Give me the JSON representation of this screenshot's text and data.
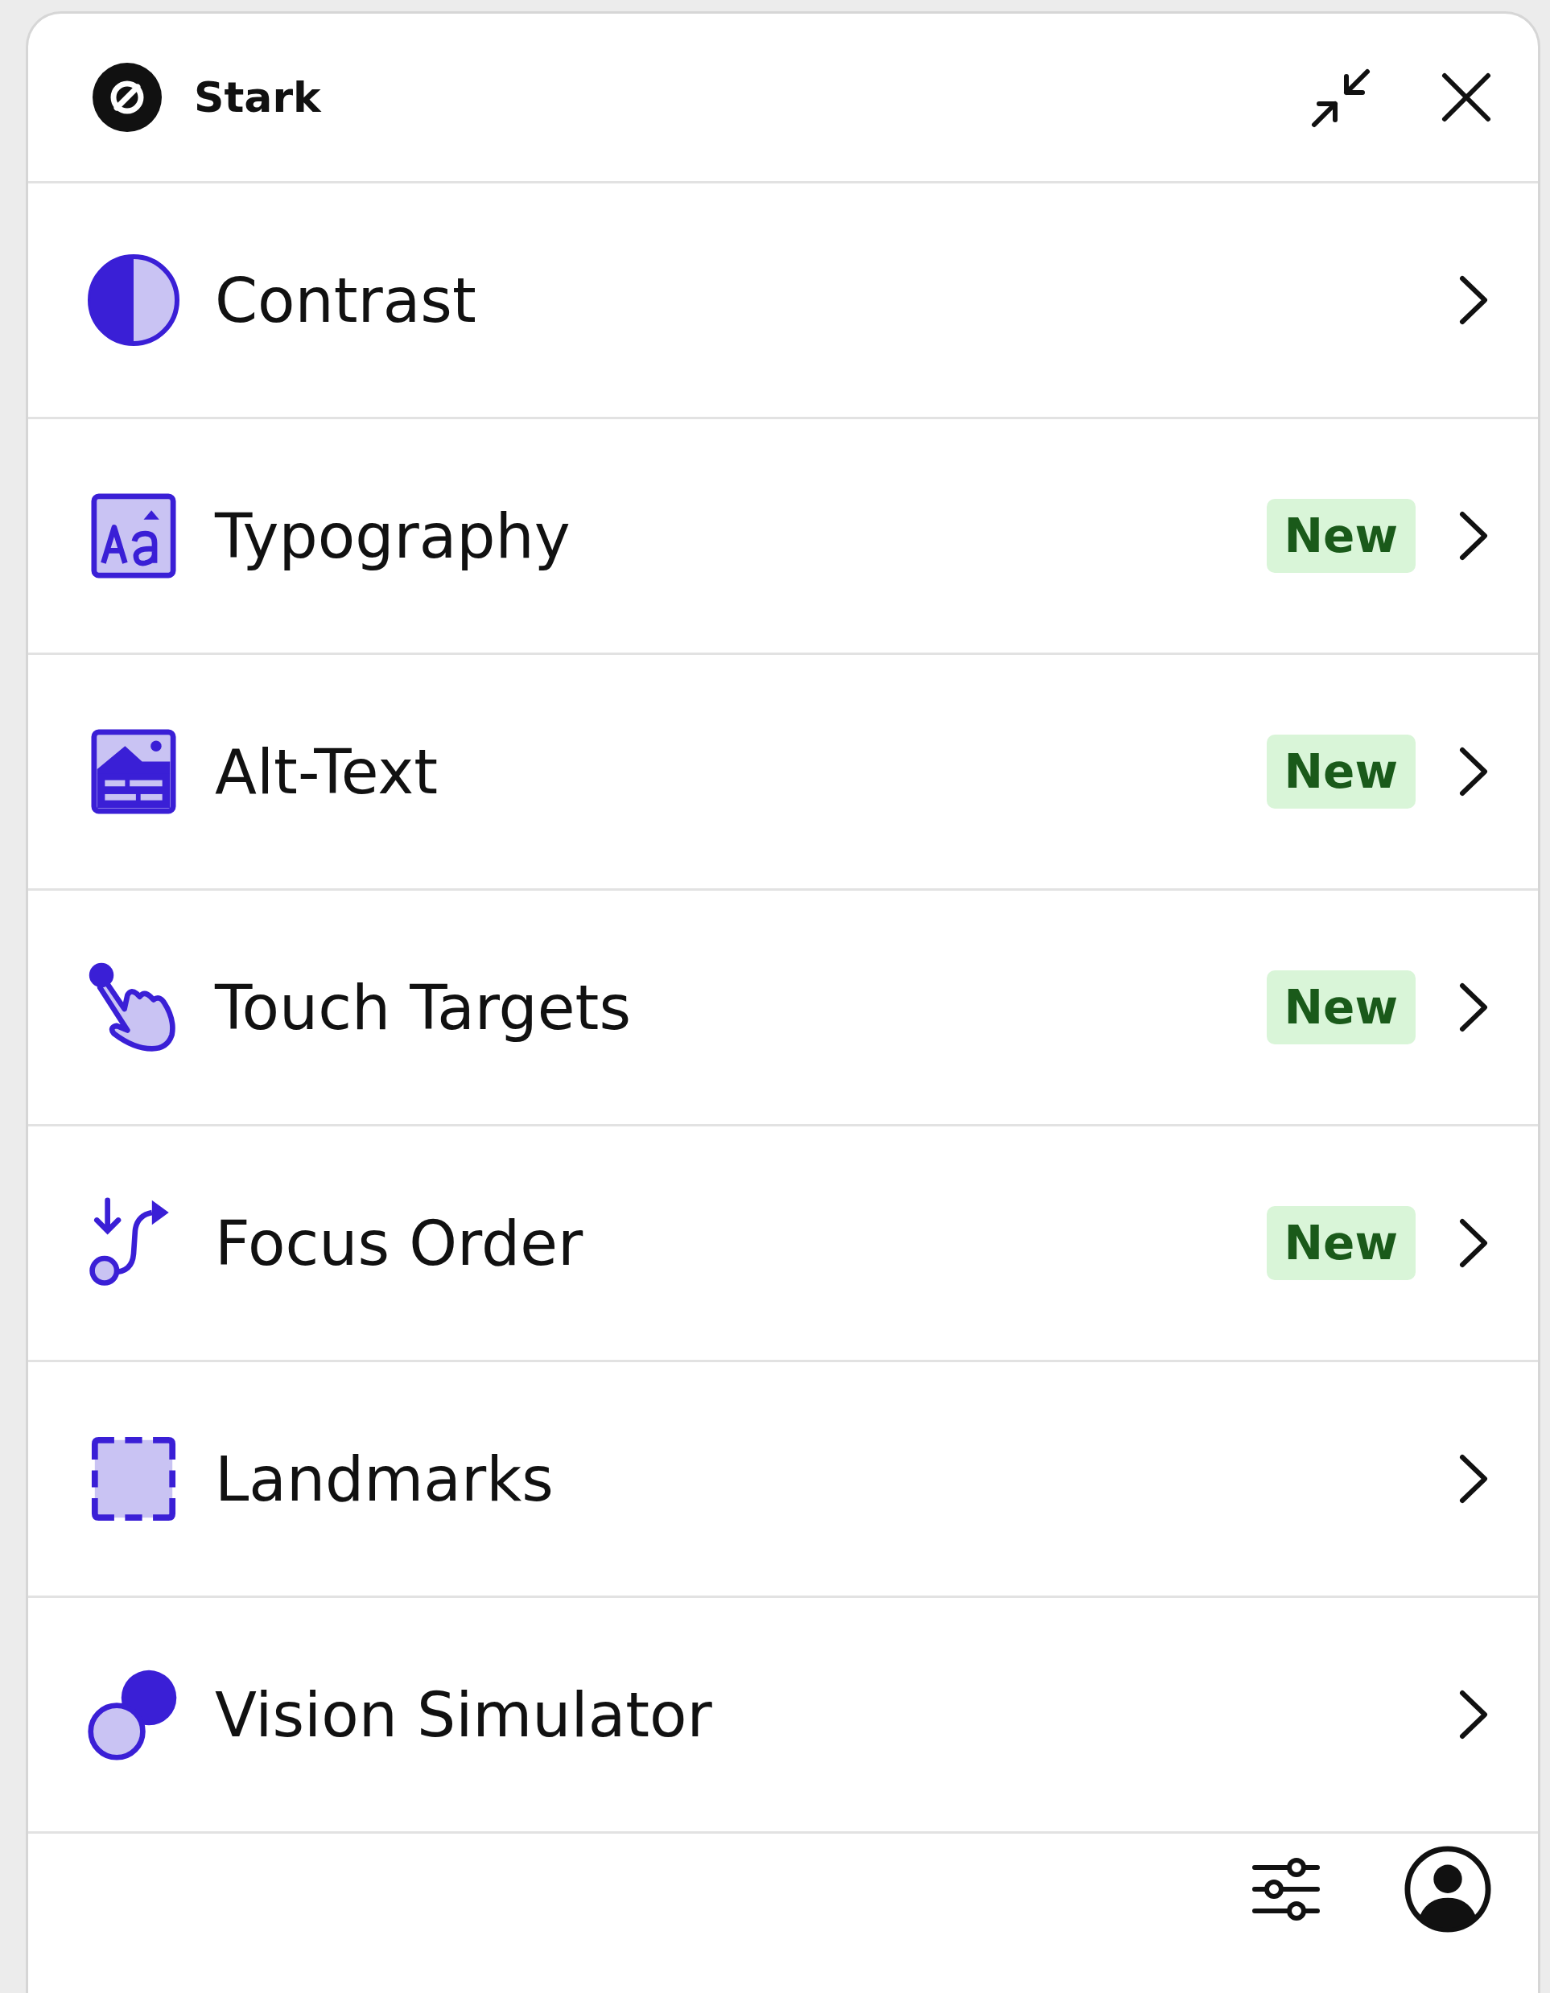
{
  "window": {
    "title": "Stark"
  },
  "tools": [
    {
      "label": "Contrast"
    },
    {
      "label": "Typography",
      "badge": "New"
    },
    {
      "label": "Alt-Text",
      "badge": "New"
    },
    {
      "label": "Touch Targets",
      "badge": "New"
    },
    {
      "label": "Focus Order",
      "badge": "New"
    },
    {
      "label": "Landmarks"
    },
    {
      "label": "Vision Simulator"
    }
  ]
}
